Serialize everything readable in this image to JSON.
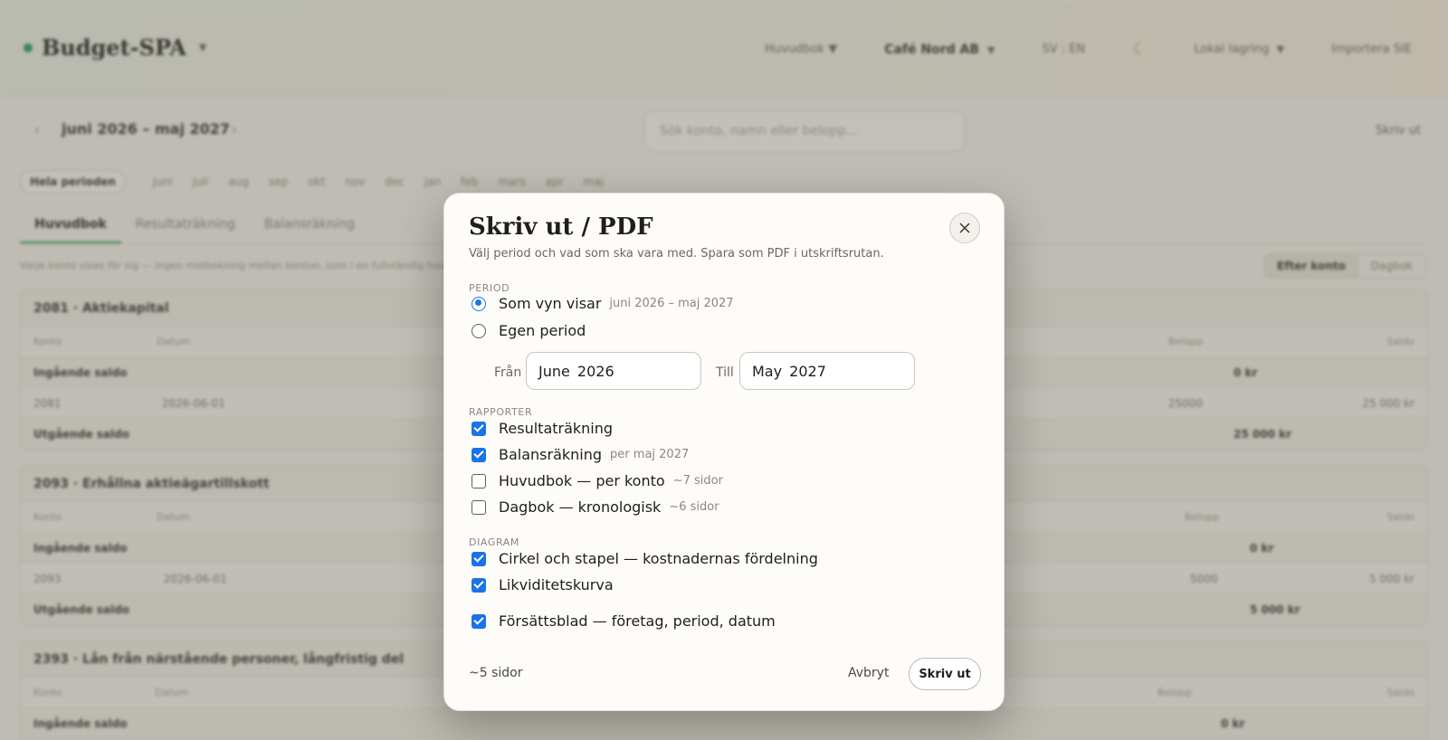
{
  "app": {
    "brand": "Budget-SPA",
    "top": {
      "ledger_select": "Huvudbok",
      "company": "Café Nord AB",
      "lang": "SV : EN",
      "storage": "Lokal lagring",
      "import": "Importera SIE"
    },
    "period": {
      "label": "juni 2026 – maj 2027",
      "search_placeholder": "Sök konto, namn eller belopp...",
      "print": "Skriv ut"
    },
    "months": {
      "whole": "Hela perioden",
      "items": [
        "juni",
        "juli",
        "aug",
        "sep",
        "okt",
        "nov",
        "dec",
        "jan",
        "feb",
        "mars",
        "apr",
        "maj"
      ]
    },
    "tabs": [
      "Huvudbok",
      "Resultaträkning",
      "Balansräkning"
    ],
    "hint": "Varje konto visas för sig — ingen motbokning mellan konton, som i en fullständig huvudbok.",
    "view_toggle": [
      "Efter konto",
      "Dagbok"
    ],
    "columns": {
      "account": "Konto",
      "date": "Datum",
      "amount": "Belopp",
      "balance": "Saldo"
    },
    "cards": [
      {
        "title": "2081 · Aktiekapital",
        "opening_label": "Ingående saldo",
        "opening": "0 kr",
        "row": {
          "account": "2081",
          "date": "2026-06-01",
          "amount": "25000",
          "balance": "25 000 kr"
        },
        "closing_label": "Utgående saldo",
        "closing": "25 000 kr"
      },
      {
        "title": "2093 · Erhållna aktieägartillskott",
        "opening_label": "Ingående saldo",
        "opening": "0 kr",
        "row": {
          "account": "2093",
          "date": "2026-06-01",
          "amount": "5000",
          "balance": "5 000 kr"
        },
        "closing_label": "Utgående saldo",
        "closing": "5 000 kr"
      },
      {
        "title": "2393 · Lån från närstående personer, långfristig del",
        "opening_label": "Ingående saldo",
        "opening": "0 kr"
      }
    ]
  },
  "modal": {
    "title": "Skriv ut / PDF",
    "subtitle": "Välj period och vad som ska vara med. Spara som PDF i utskriftsrutan.",
    "period_section": "PERIOD",
    "period_options": [
      {
        "label": "Som vyn visar",
        "meta": "juni 2026 – maj 2027",
        "selected": true
      },
      {
        "label": "Egen period",
        "meta": "",
        "selected": false
      }
    ],
    "from_label": "Från",
    "from_value": "June 2026",
    "to_label": "Till",
    "to_value": "May 2027",
    "reports_section": "RAPPORTER",
    "reports": [
      {
        "label": "Resultaträkning",
        "meta": "",
        "checked": true
      },
      {
        "label": "Balansräkning",
        "meta": "per maj 2027",
        "checked": true
      },
      {
        "label": "Huvudbok — per konto",
        "meta": "~7 sidor",
        "checked": false
      },
      {
        "label": "Dagbok — kronologisk",
        "meta": "~6 sidor",
        "checked": false
      }
    ],
    "charts_section": "DIAGRAM",
    "charts": [
      {
        "label": "Cirkel och stapel — kostnadernas fördelning",
        "checked": true
      },
      {
        "label": "Likviditetskurva",
        "checked": true
      }
    ],
    "cover": {
      "label": "Försättsblad — företag, period, datum",
      "checked": true
    },
    "pages_estimate": "~5 sidor",
    "cancel": "Avbryt",
    "print": "Skriv ut"
  },
  "colors": {
    "accent": "#1a73e8",
    "brand_dot": "#2f9c5a",
    "moon": "#d6962d"
  }
}
